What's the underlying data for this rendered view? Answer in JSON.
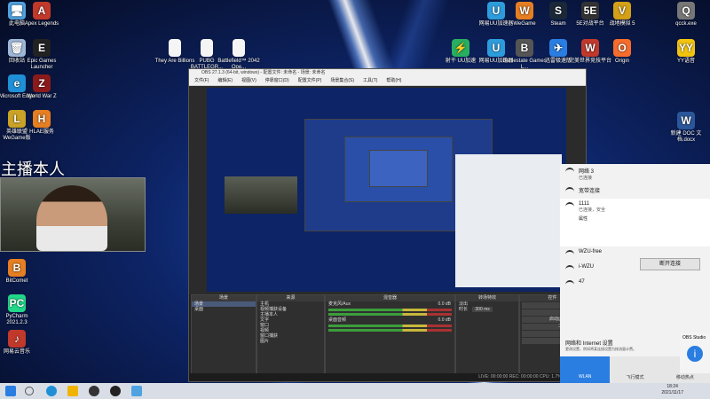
{
  "desktop": {
    "left_icons": [
      {
        "label": "此电脑",
        "glyph": "🖥",
        "color": "#4fa3e0"
      },
      {
        "label": "Apex Legends",
        "glyph": "A",
        "color": "#c0392b"
      },
      {
        "label": "回收站",
        "glyph": "🗑",
        "color": "#9fb8d8"
      },
      {
        "label": "Epic Games Launcher",
        "glyph": "E",
        "color": "#222"
      },
      {
        "label": "Microsoft Edge",
        "glyph": "e",
        "color": "#1f8fd6"
      },
      {
        "label": "World War Z",
        "glyph": "Z",
        "color": "#8b1a1a"
      },
      {
        "label": "英雄联盟 WeGame版",
        "glyph": "L",
        "color": "#c9a227"
      },
      {
        "label": "HLAE服务",
        "glyph": "H",
        "color": "#e67e22"
      },
      {
        "label": "BitComet",
        "glyph": "B",
        "color": "#e67e22"
      },
      {
        "label": "PyCharm 2021.2.3",
        "glyph": "PC",
        "color": "#21d789"
      },
      {
        "label": "网易云音乐",
        "glyph": "♪",
        "color": "#c0392b"
      }
    ],
    "mid_icons": [
      {
        "label": "They Are Billions"
      },
      {
        "label": "PUBG BATTLEGR..."
      },
      {
        "label": "Battlefield™ 2042 Ope..."
      }
    ],
    "right_icons": [
      {
        "label": "网易UU加速器",
        "glyph": "U",
        "color": "#2d9cdb"
      },
      {
        "label": "WeGame",
        "glyph": "W",
        "color": "#e67e22"
      },
      {
        "label": "Steam",
        "glyph": "S",
        "color": "#1b2838"
      },
      {
        "label": "5E对战平台",
        "glyph": "5E",
        "color": "#333"
      },
      {
        "label": "战地模拟 5",
        "glyph": "V",
        "color": "#d4a017"
      },
      {
        "label": "qcck.exe",
        "glyph": "Q",
        "color": "#777"
      },
      {
        "label": "射干 UU加速",
        "glyph": "⚡",
        "color": "#27ae60"
      },
      {
        "label": "网易UU加速器",
        "glyph": "U",
        "color": "#2d9cdb"
      },
      {
        "label": "Battlestate Games L...",
        "glyph": "B",
        "color": "#555"
      },
      {
        "label": "迅雷极速版",
        "glyph": "✈",
        "color": "#2a7de1"
      },
      {
        "label": "完美世界竞技平台",
        "glyph": "W",
        "color": "#c0392b"
      },
      {
        "label": "Origin",
        "glyph": "O",
        "color": "#f56c2d"
      },
      {
        "label": "YY语音",
        "glyph": "YY",
        "color": "#f1c40f"
      },
      {
        "label": "新建 DOC 文档.docx",
        "glyph": "W",
        "color": "#2b579a"
      }
    ]
  },
  "webcam": {
    "overlay_text": "主播本人"
  },
  "obs": {
    "title": "OBS 27.1.3 (64-bit, windows) - 配置文件: 未命名 - 场景: 未命名",
    "menu": [
      "文件(F)",
      "编辑(E)",
      "视图(V)",
      "停靠窗口(D)",
      "配置文件(P)",
      "场景集合(S)",
      "工具(T)",
      "帮助(H)"
    ],
    "docks": {
      "scenes": {
        "header": "场景",
        "items": [
          "场景",
          "桌面"
        ]
      },
      "sources": {
        "header": "来源",
        "items": [
          "主机",
          "视频捕获设备",
          "主播本人",
          "文字",
          "窗口",
          "视频",
          "窗口捕获",
          "图片"
        ]
      },
      "mixer": {
        "header": "混音器",
        "channels": [
          {
            "name": "麦克风/Aux",
            "db": "0.0 dB"
          },
          {
            "name": "桌面音频",
            "db": "0.0 dB"
          }
        ]
      },
      "transitions": {
        "header": "转场特效",
        "type": "淡出",
        "duration_label": "时长",
        "duration": "300 ms"
      },
      "controls": {
        "header": "控件",
        "buttons": [
          "开始推流",
          "开始录制",
          "启动虚拟摄像机",
          "工作室模式",
          "设置",
          "退出"
        ]
      }
    },
    "status": "LIVE: 00:00:00   REC: 00:00:00   CPU: 1.7%, 60.00 fps"
  },
  "network": {
    "items": [
      {
        "name": "网络 3",
        "status": "已连接"
      },
      {
        "name": "宽带连接",
        "status": ""
      },
      {
        "name": "1111",
        "status": "已连接，安全"
      },
      {
        "name": "WZU-free",
        "status": ""
      },
      {
        "name": "i-WZU",
        "status": ""
      },
      {
        "name": "47",
        "status": ""
      }
    ],
    "properties_label": "属性",
    "disconnect_button": "断开连接",
    "settings_title": "网络和 Internet 设置",
    "settings_sub": "更改设置，例如将某连接设置为按流量计费。",
    "quick": [
      "WLAN",
      "飞行模式",
      "移动热点"
    ]
  },
  "toast": {
    "app": "OBS Studio"
  },
  "taskbar": {
    "time": "18:24",
    "date": "2021/11/17"
  }
}
